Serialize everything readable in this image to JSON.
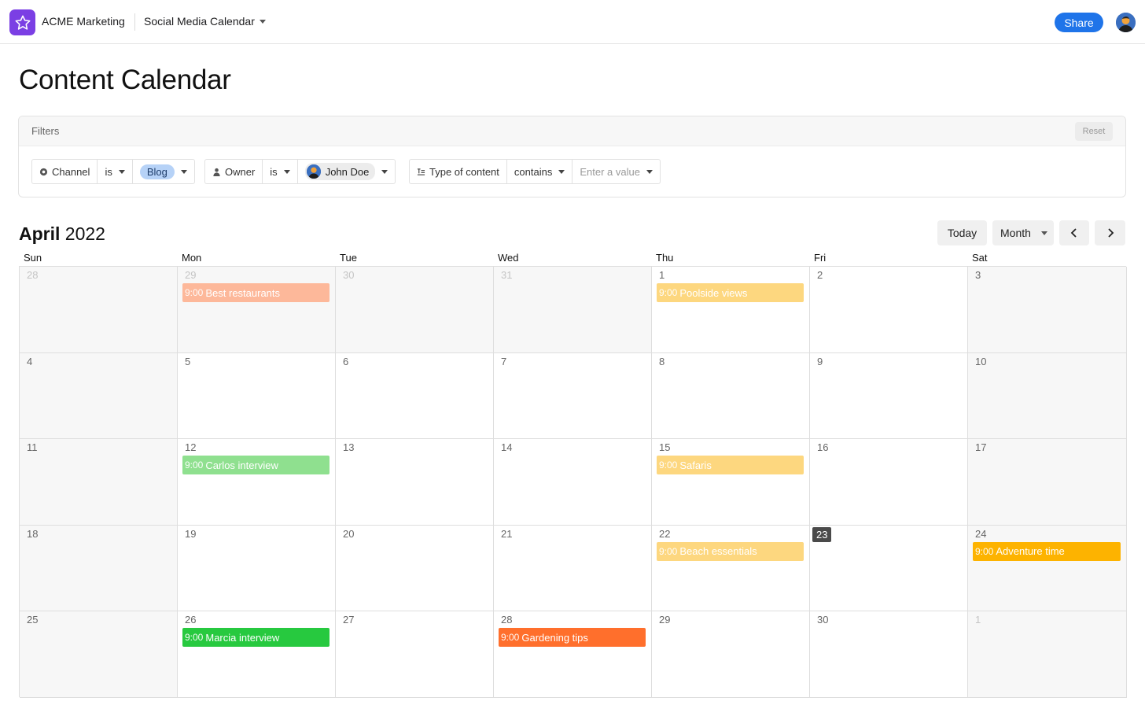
{
  "app": {
    "org_name": "ACME Marketing",
    "calendar_name": "Social Media Calendar",
    "share_label": "Share",
    "logo_icon": "star-icon",
    "accent": "#1f74e9",
    "logo_color": "#7b3fe4"
  },
  "page_title": "Content Calendar",
  "filters": {
    "label": "Filters",
    "reset_label": "Reset",
    "channel": {
      "field": "Channel",
      "op": "is",
      "value": "Blog"
    },
    "owner": {
      "field": "Owner",
      "op": "is",
      "value": "John Doe"
    },
    "content_type": {
      "field": "Type of content",
      "op": "contains",
      "placeholder": "Enter a value"
    }
  },
  "calendar": {
    "month": "April",
    "year": "2022",
    "today_label": "Today",
    "view_label": "Month",
    "weekdays": [
      "Sun",
      "Mon",
      "Tue",
      "Wed",
      "Thu",
      "Fri",
      "Sat"
    ],
    "weeks": [
      [
        {
          "day": "28",
          "other": true
        },
        {
          "day": "29",
          "other": true,
          "event": {
            "time": "9:00",
            "title": "Best restaurants",
            "color": "#fdb89a"
          }
        },
        {
          "day": "30",
          "other": true
        },
        {
          "day": "31",
          "other": true
        },
        {
          "day": "1",
          "event": {
            "time": "9:00",
            "title": "Poolside views",
            "color": "#fdd77f"
          }
        },
        {
          "day": "2"
        },
        {
          "day": "3"
        }
      ],
      [
        {
          "day": "4"
        },
        {
          "day": "5"
        },
        {
          "day": "6"
        },
        {
          "day": "7"
        },
        {
          "day": "8"
        },
        {
          "day": "9"
        },
        {
          "day": "10"
        }
      ],
      [
        {
          "day": "11"
        },
        {
          "day": "12",
          "event": {
            "time": "9:00",
            "title": "Carlos interview",
            "color": "#8fe08f"
          }
        },
        {
          "day": "13"
        },
        {
          "day": "14"
        },
        {
          "day": "15",
          "event": {
            "time": "9:00",
            "title": "Safaris",
            "color": "#fdd77f"
          }
        },
        {
          "day": "16"
        },
        {
          "day": "17"
        }
      ],
      [
        {
          "day": "18"
        },
        {
          "day": "19"
        },
        {
          "day": "20"
        },
        {
          "day": "21"
        },
        {
          "day": "22",
          "event": {
            "time": "9:00",
            "title": "Beach essentials",
            "color": "#fdd77f"
          }
        },
        {
          "day": "23",
          "today": true
        },
        {
          "day": "24",
          "event": {
            "time": "9:00",
            "title": "Adventure time",
            "color": "#fdb300"
          }
        }
      ],
      [
        {
          "day": "25"
        },
        {
          "day": "26",
          "event": {
            "time": "9:00",
            "title": "Marcia interview",
            "color": "#27c93f"
          }
        },
        {
          "day": "27"
        },
        {
          "day": "28",
          "event": {
            "time": "9:00",
            "title": "Gardening tips",
            "color": "#ff6f2c"
          }
        },
        {
          "day": "29"
        },
        {
          "day": "30"
        },
        {
          "day": "1",
          "other": true
        }
      ]
    ]
  }
}
